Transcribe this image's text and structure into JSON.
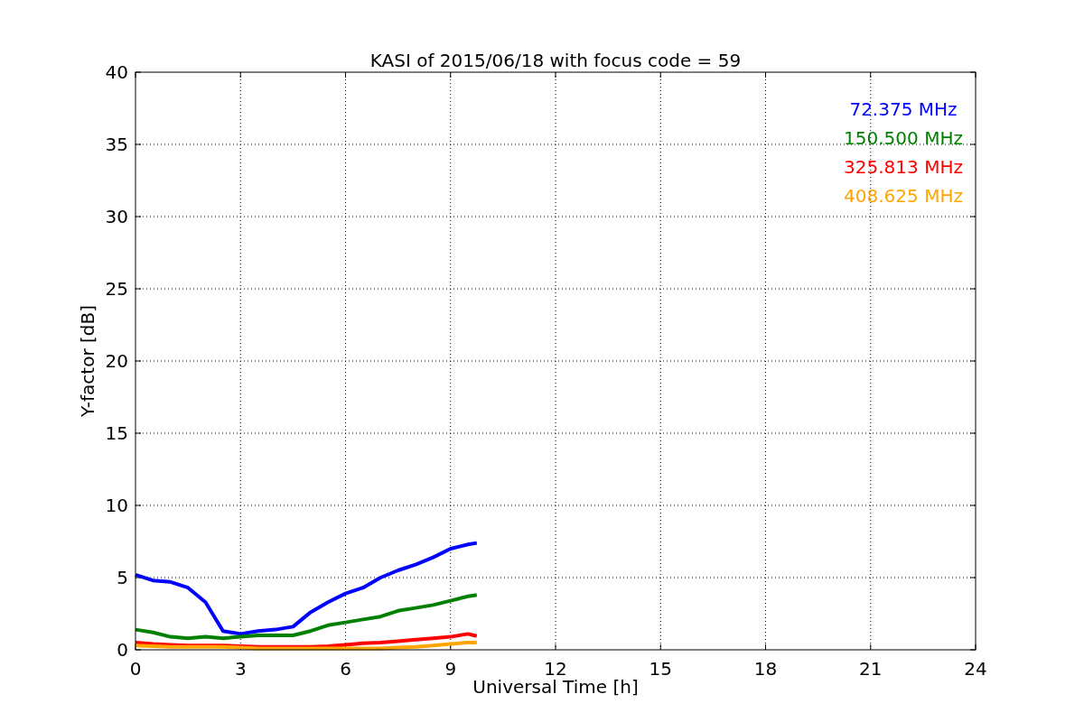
{
  "figure": {
    "chart_data": {
      "type": "line",
      "title": "KASI of 2015/06/18 with focus code = 59",
      "xlabel": "Universal Time [h]",
      "ylabel": "Y-factor [dB]",
      "x": [
        0,
        0.5,
        1,
        1.5,
        2,
        2.5,
        3,
        3.5,
        4,
        4.5,
        5,
        5.5,
        6,
        6.5,
        7,
        7.5,
        8,
        8.5,
        9,
        9.5,
        9.75
      ],
      "series": [
        {
          "name": "72.375 MHz",
          "color": "#0000ff",
          "values": [
            5.2,
            4.8,
            4.7,
            4.3,
            3.3,
            1.3,
            1.1,
            1.3,
            1.4,
            1.6,
            2.6,
            3.3,
            3.9,
            4.3,
            5.0,
            5.5,
            5.9,
            6.4,
            7.0,
            7.3,
            7.4
          ]
        },
        {
          "name": "150.500 MHz",
          "color": "#008000",
          "values": [
            1.4,
            1.2,
            0.9,
            0.8,
            0.9,
            0.8,
            0.9,
            1.0,
            1.0,
            1.0,
            1.3,
            1.7,
            1.9,
            2.1,
            2.3,
            2.7,
            2.9,
            3.1,
            3.4,
            3.7,
            3.8
          ]
        },
        {
          "name": "325.813 MHz",
          "color": "#ff0000",
          "values": [
            0.5,
            0.4,
            0.35,
            0.3,
            0.3,
            0.3,
            0.25,
            0.2,
            0.2,
            0.2,
            0.2,
            0.25,
            0.35,
            0.45,
            0.5,
            0.6,
            0.7,
            0.8,
            0.9,
            1.1,
            0.95
          ]
        },
        {
          "name": "408.625 MHz",
          "color": "#ffa500",
          "values": [
            0.3,
            0.25,
            0.2,
            0.2,
            0.2,
            0.2,
            0.15,
            0.1,
            0.1,
            0.1,
            0.1,
            0.1,
            0.1,
            0.1,
            0.1,
            0.15,
            0.2,
            0.3,
            0.4,
            0.5,
            0.5
          ]
        }
      ],
      "grid": true,
      "xlim": [
        0,
        24
      ],
      "ylim": [
        0,
        40
      ],
      "xticks": [
        0,
        3,
        6,
        9,
        12,
        15,
        18,
        21,
        24
      ],
      "yticks": [
        0,
        5,
        10,
        15,
        20,
        25,
        30,
        35,
        40
      ]
    }
  }
}
